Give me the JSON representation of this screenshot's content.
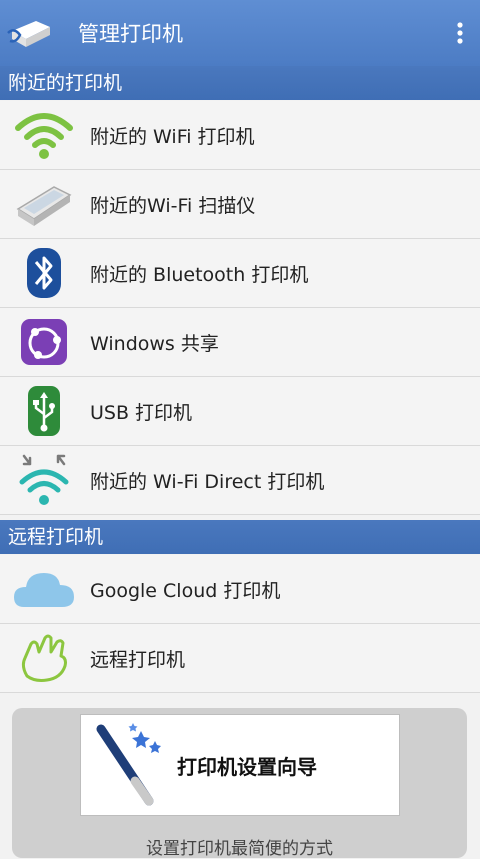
{
  "appbar": {
    "title": "管理打印机",
    "app_icon": "printer-hand-icon",
    "menu_icon": "overflow-menu-icon"
  },
  "sections": {
    "nearby": {
      "title": "附近的打印机",
      "items": [
        {
          "label": "附近的 WiFi 打印机",
          "icon": "wifi-icon",
          "color": "#7dc242"
        },
        {
          "label": "附近的Wi-Fi 扫描仪",
          "icon": "scanner-icon",
          "color": "#9aa0a6"
        },
        {
          "label": "附近的 Bluetooth 打印机",
          "icon": "bluetooth-icon",
          "color": "#1d4f9c"
        },
        {
          "label": "Windows 共享",
          "icon": "windows-share-icon",
          "color": "#7b3fb5"
        },
        {
          "label": "USB 打印机",
          "icon": "usb-icon",
          "color": "#2e8b3a"
        },
        {
          "label": "附近的 Wi-Fi Direct 打印机",
          "icon": "wifi-direct-icon",
          "color": "#2bb6b0"
        }
      ]
    },
    "remote": {
      "title": "远程打印机",
      "items": [
        {
          "label": "Google Cloud 打印机",
          "icon": "cloud-icon",
          "color": "#8ec6ea"
        },
        {
          "label": "远程打印机",
          "icon": "hand-icon",
          "color": "#8cc63f"
        }
      ]
    }
  },
  "wizard": {
    "label": "打印机设置向导",
    "icon": "magic-wand-icon",
    "tagline": "设置打印机最简便的方式"
  },
  "colors": {
    "appbar": "#5483c9",
    "section": "#4575bb"
  }
}
